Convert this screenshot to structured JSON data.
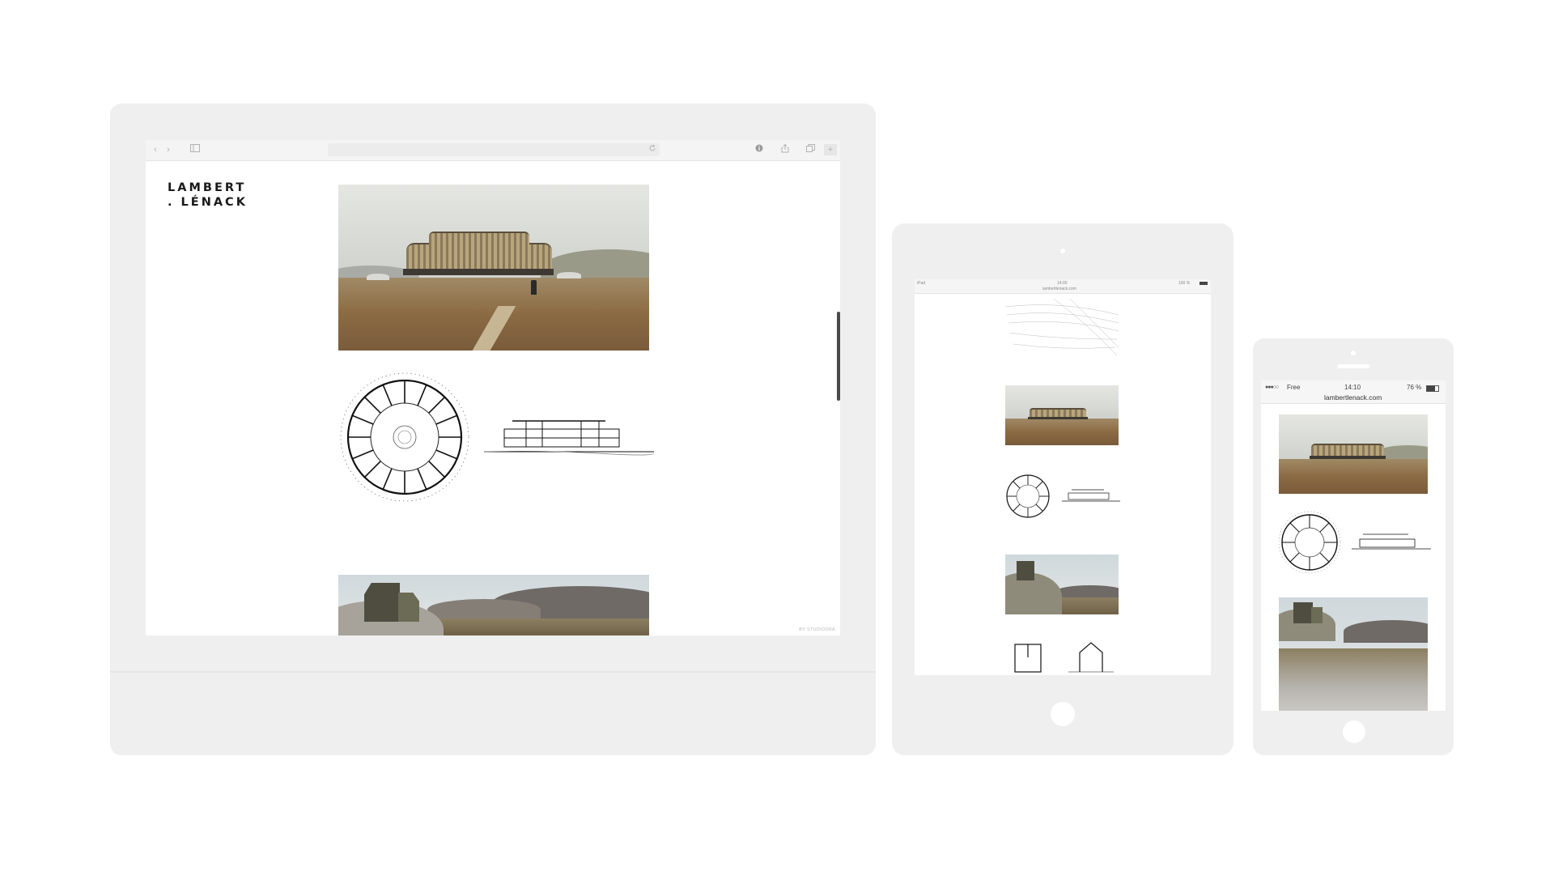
{
  "desktop": {
    "toolbar": {
      "back_icon": "chevron-left-icon",
      "forward_icon": "chevron-right-icon",
      "sidebar_icon": "sidebar-icon",
      "reload_icon": "reload-icon",
      "info_icon": "info-icon",
      "share_icon": "share-icon",
      "tabs_icon": "tabs-icon",
      "new_tab_label": "+"
    },
    "site": {
      "logo": "LAMBERT\n. LÉNACK",
      "footer_note": "BY STUDIODRA"
    }
  },
  "tablet": {
    "status": {
      "carrier": "iPad",
      "time": "14:00",
      "url": "lambertlenack.com",
      "battery": "100 %"
    }
  },
  "phone": {
    "status": {
      "carrier": "Free",
      "time": "14:10",
      "battery": "76 %",
      "url": "lambertlenack.com"
    }
  }
}
